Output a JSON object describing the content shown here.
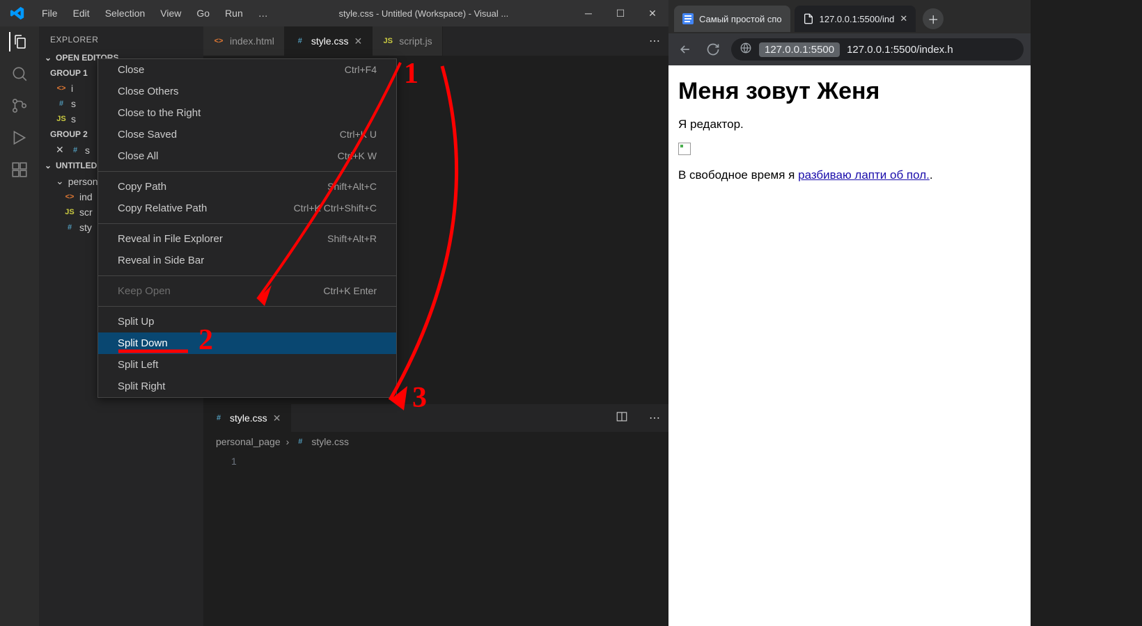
{
  "vscode": {
    "menu": [
      "File",
      "Edit",
      "Selection",
      "View",
      "Go",
      "Run",
      "…"
    ],
    "window_title": "style.css - Untitled (Workspace) - Visual ...",
    "sidebar": {
      "title": "EXPLORER",
      "open_editors_label": "OPEN EDITORS",
      "group1_label": "GROUP 1",
      "group2_label": "GROUP 2",
      "workspace_label": "UNTITLED (WORKSPACE)",
      "folder_label": "personal_page",
      "group1_files": [
        {
          "name": "index.html",
          "icon": "html",
          "short": "i"
        },
        {
          "name": "style.css",
          "icon": "css",
          "short": "s"
        },
        {
          "name": "script.js",
          "icon": "js",
          "short": "s"
        }
      ],
      "group2_files": [
        {
          "name": "style.css",
          "icon": "css",
          "short": "s"
        }
      ],
      "folder_files": [
        {
          "name": "index.html",
          "icon": "html",
          "short": "ind"
        },
        {
          "name": "script.js",
          "icon": "js",
          "short": "scr"
        },
        {
          "name": "style.css",
          "icon": "css",
          "short": "sty"
        }
      ]
    },
    "tabs": [
      {
        "name": "index.html",
        "icon": "html",
        "active": false
      },
      {
        "name": "style.css",
        "icon": "css",
        "active": true
      },
      {
        "name": "script.js",
        "icon": "js",
        "active": false
      }
    ],
    "split_tab": {
      "name": "style.css",
      "icon": "css"
    },
    "breadcrumb": {
      "folder": "personal_page",
      "file": "style.css"
    },
    "line_number": "1"
  },
  "context_menu": {
    "items": [
      {
        "label": "Close",
        "key": "Ctrl+F4"
      },
      {
        "label": "Close Others",
        "key": ""
      },
      {
        "label": "Close to the Right",
        "key": ""
      },
      {
        "label": "Close Saved",
        "key": "Ctrl+K U"
      },
      {
        "label": "Close All",
        "key": "Ctrl+K W"
      },
      {
        "sep": true
      },
      {
        "label": "Copy Path",
        "key": "Shift+Alt+C"
      },
      {
        "label": "Copy Relative Path",
        "key": "Ctrl+K Ctrl+Shift+C"
      },
      {
        "sep": true
      },
      {
        "label": "Reveal in File Explorer",
        "key": "Shift+Alt+R"
      },
      {
        "label": "Reveal in Side Bar",
        "key": ""
      },
      {
        "sep": true
      },
      {
        "label": "Keep Open",
        "key": "Ctrl+K Enter",
        "disabled": true
      },
      {
        "sep": true
      },
      {
        "label": "Split Up",
        "key": ""
      },
      {
        "label": "Split Down",
        "key": "",
        "highlighted": true
      },
      {
        "label": "Split Left",
        "key": ""
      },
      {
        "label": "Split Right",
        "key": ""
      }
    ]
  },
  "browser": {
    "tabs": [
      {
        "title": "Самый простой спо",
        "favicon": "docs"
      },
      {
        "title": "127.0.0.1:5500/ind",
        "favicon": "file",
        "active": true
      }
    ],
    "url_host": "127.0.0.1:5500",
    "url_path": "127.0.0.1:5500/index.h",
    "page": {
      "heading": "Меня зовут Женя",
      "para1": "Я редактор.",
      "para2_prefix": "В свободное время я ",
      "link_text": "разбиваю лапти об пол.",
      "para2_suffix": "."
    }
  },
  "annotations": {
    "n1": "1",
    "n2": "2",
    "n3": "3"
  }
}
